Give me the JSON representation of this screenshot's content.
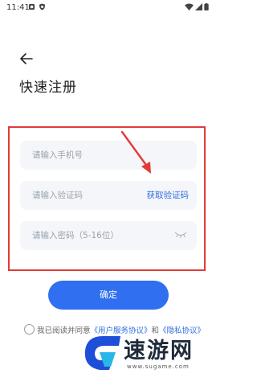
{
  "status_bar": {
    "time": "11:41",
    "icons_left": [
      "notification-icon",
      "shield-icon"
    ],
    "icons_right": [
      "wifi-icon",
      "signal-icon",
      "battery-icon"
    ]
  },
  "header": {
    "back_icon": "back-arrow-icon",
    "title": "快速注册"
  },
  "form": {
    "phone_placeholder": "请输入手机号",
    "code_placeholder": "请输入验证码",
    "get_code_label": "获取验证码",
    "password_placeholder": "请输入密码（5-16位）",
    "password_toggle_icon": "eye-closed-icon"
  },
  "annotation": {
    "highlight_color": "#e23a3a",
    "arrow_color": "#e23a3a"
  },
  "confirm_label": "确定",
  "agreement": {
    "prefix": "我已阅读并同意",
    "user_agreement": "《用户服务协议》",
    "and": "和",
    "privacy_policy": "《隐私协议》"
  },
  "watermark": {
    "title": "速游网",
    "url": "www.sugame.com"
  },
  "colors": {
    "accent": "#2f6ff0",
    "link": "#2f6fe0",
    "field_bg": "#f4f6f9"
  }
}
